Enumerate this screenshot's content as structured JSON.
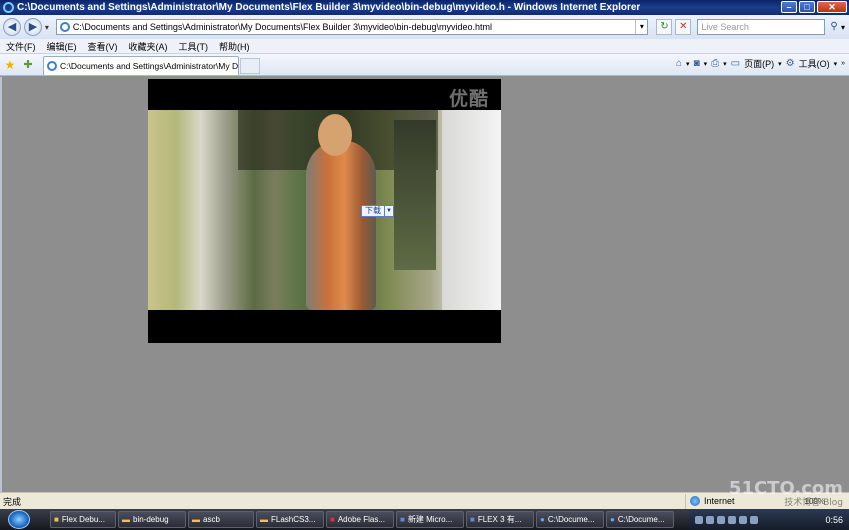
{
  "window": {
    "title": "C:\\Documents and Settings\\Administrator\\My Documents\\Flex Builder 3\\myvideo\\bin-debug\\myvideo.h - Windows Internet Explorer",
    "minimize": "–",
    "maximize": "□",
    "close": "✕"
  },
  "nav": {
    "back": "◀",
    "forward": "▶",
    "address": "C:\\Documents and Settings\\Administrator\\My Documents\\Flex Builder 3\\myvideo\\bin-debug\\myvideo.html",
    "search_placeholder": "Live Search"
  },
  "menu": [
    "文件(F)",
    "编辑(E)",
    "查看(V)",
    "收藏夹(A)",
    "工具(T)",
    "帮助(H)"
  ],
  "tab": {
    "title": "C:\\Documents and Settings\\Administrator\\My Docume..."
  },
  "commandbar": {
    "page": "页面(P)",
    "tools": "工具(O)"
  },
  "video": {
    "logo": "优酷",
    "download_label": "下载"
  },
  "status": {
    "text": "完成",
    "zone": "Internet",
    "zoom": "100%"
  },
  "watermark": {
    "main": "51CTO.com",
    "sub": "技术博客  Blog"
  },
  "taskbar": {
    "items": [
      "Flex Debu...",
      "bin-debug",
      "ascb",
      "FLashCS3...",
      "Adobe Flas...",
      "新建 Micro...",
      "FLEX 3 有...",
      "C:\\Docume...",
      "C:\\Docume..."
    ],
    "clock": "0:56"
  }
}
